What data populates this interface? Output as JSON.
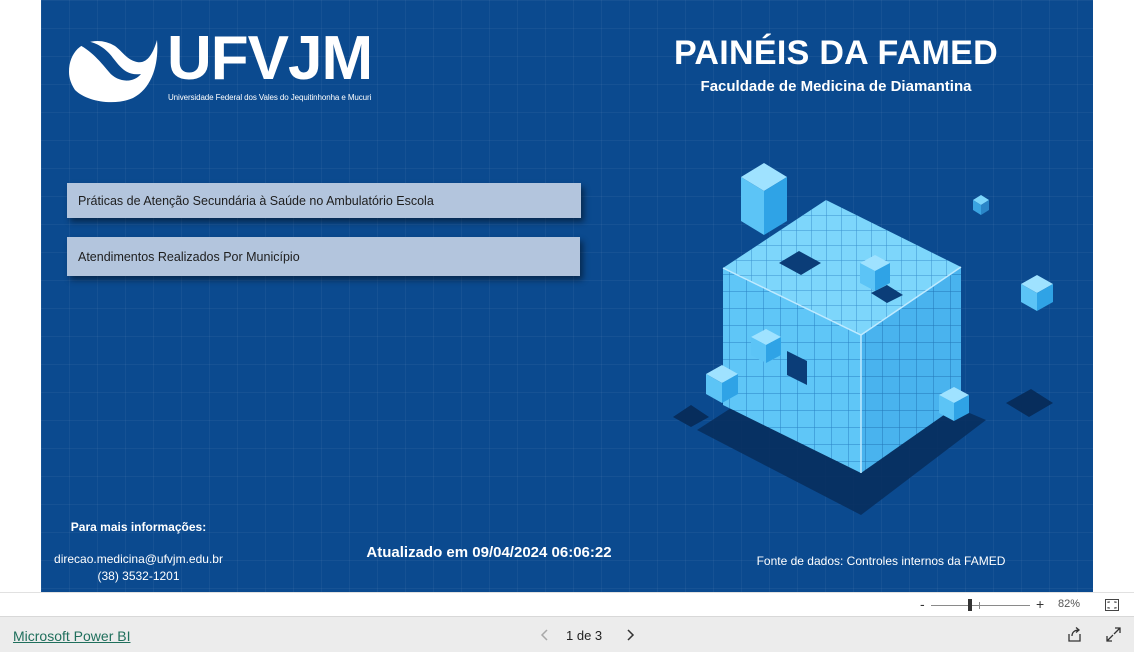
{
  "report": {
    "logo": {
      "wordmark": "UFVJM",
      "subtitle": "Universidade Federal dos Vales do Jequitinhonha e Mucuri"
    },
    "title": "PAINÉIS DA FAMED",
    "subtitle": "Faculdade de Medicina de Diamantina",
    "nav_buttons": [
      {
        "label": "Práticas de Atenção Secundária à Saúde no Ambulatório Escola"
      },
      {
        "label": "Atendimentos Realizados Por Município"
      }
    ],
    "info": {
      "heading": "Para mais informações:",
      "email": "direcao.medicina@ufvjm.edu.br",
      "phone": "(38) 3532-1201"
    },
    "updated": "Atualizado em 09/04/2024 06:06:22",
    "source": "Fonte de dados: Controles internos da FAMED",
    "colors": {
      "background": "#0b4a8f",
      "button": "#b3c5dd",
      "cube": "#5ec3f5"
    }
  },
  "zoom": {
    "minus": "-",
    "plus": "+",
    "value": "82%",
    "level": 0.82
  },
  "footer": {
    "brand_link": "Microsoft Power BI",
    "page_indicator": "1 de 3",
    "icons": [
      "chevron-left-icon",
      "chevron-right-icon",
      "share-icon",
      "expand-icon",
      "fit-to-page-icon"
    ]
  }
}
